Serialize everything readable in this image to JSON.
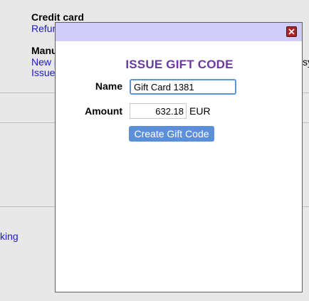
{
  "background": {
    "credit_card_heading": "Credit card",
    "refund_link": "Refun",
    "manual_heading": "Manu",
    "new_link": "New p",
    "issue_link": "Issue",
    "right_fragment": "sy",
    "left_link_fragment": "king"
  },
  "modal": {
    "heading": "ISSUE GIFT CODE",
    "name_label": "Name",
    "name_value": "Gift Card 1381",
    "amount_label": "Amount",
    "amount_value": "632.18",
    "currency": "EUR",
    "submit_label": "Create Gift Code"
  },
  "colors": {
    "titlebar": "#cfcdf8",
    "heading": "#6b3aa0",
    "button": "#5b8fd9",
    "close": "#a72424",
    "link": "#1a1ad6"
  }
}
